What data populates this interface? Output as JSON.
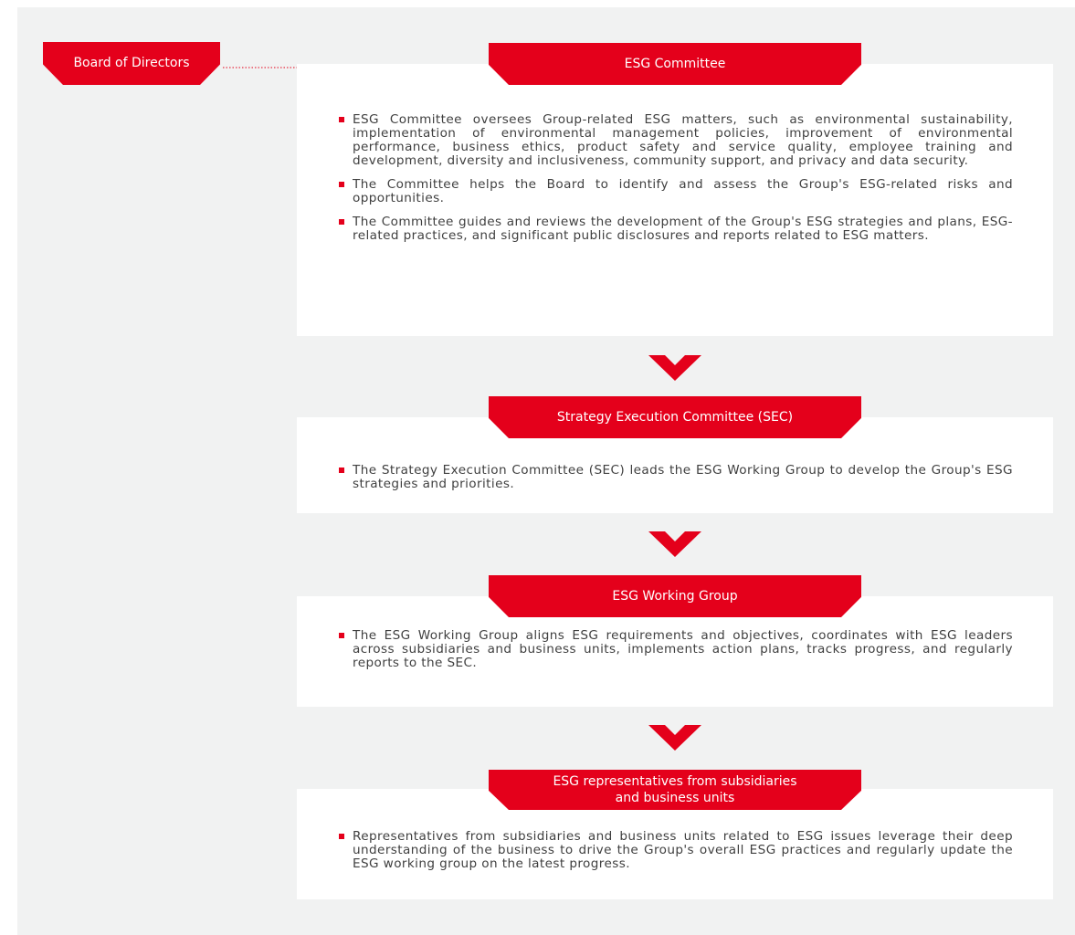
{
  "colors": {
    "accent": "#e4001b",
    "panel": "#f1f2f2",
    "card": "#ffffff",
    "text": "#3f3f3f"
  },
  "board": {
    "label": "Board of Directors"
  },
  "esg_committee": {
    "title": "ESG Committee",
    "bullets": [
      "ESG Committee oversees Group-related ESG matters, such as environmental sustainability, implementation of environmental management policies, improvement of environmental performance, business ethics, product safety and service quality, employee training and development, diversity and inclusiveness, community support, and privacy and data security.",
      "The Committee helps the Board to identify and assess the Group's ESG-related risks and opportunities.",
      "The Committee guides and reviews the development of the Group's ESG strategies and plans, ESG-related practices, and significant public disclosures and reports related to ESG matters."
    ]
  },
  "sec": {
    "title": "Strategy Execution Committee (SEC)",
    "bullets": [
      "The Strategy Execution Committee (SEC) leads the ESG Working Group to develop the Group's ESG strategies and priorities."
    ]
  },
  "working_group": {
    "title": "ESG Working Group",
    "bullets": [
      "The ESG Working Group aligns ESG requirements and objectives, coordinates with ESG leaders across subsidiaries and business units, implements action plans, tracks progress, and regularly reports to the SEC."
    ]
  },
  "representatives": {
    "title_line1": "ESG representatives from subsidiaries",
    "title_line2": "and business units",
    "bullets": [
      "Representatives from subsidiaries and business units related to ESG issues leverage their deep understanding of the business to drive the Group's overall ESG practices and regularly update the ESG working group on the latest progress."
    ]
  }
}
